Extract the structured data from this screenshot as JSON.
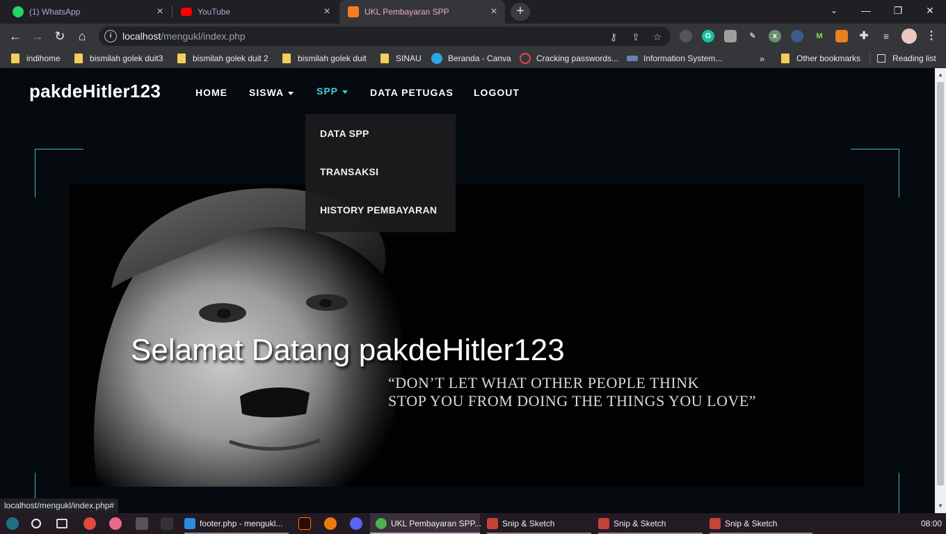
{
  "browser": {
    "tabs": [
      {
        "title": "(1) WhatsApp",
        "icon": "whatsapp-icon",
        "color": "#25d366"
      },
      {
        "title": "YouTube",
        "icon": "youtube-icon",
        "color": "#ff0000"
      },
      {
        "title": "UKL Pembayaran SPP",
        "icon": "xampp-icon",
        "color": "#fb7a24"
      }
    ],
    "new_tab": "+",
    "url_host": "localhost",
    "url_path": "/mengukl/index.php",
    "status_url": "localhost/mengukl/index.php#",
    "bookmarks": [
      {
        "label": "indihome",
        "type": "folder"
      },
      {
        "label": "bismilah golek duit3",
        "type": "folder"
      },
      {
        "label": "bismilah golek duit 2",
        "type": "folder"
      },
      {
        "label": "bismilah golek duit",
        "type": "folder"
      },
      {
        "label": "SINAU",
        "type": "folder"
      },
      {
        "label": "Beranda - Canva",
        "type": "canva"
      },
      {
        "label": "Cracking passwords...",
        "type": "site"
      },
      {
        "label": "Information System...",
        "type": "site"
      }
    ],
    "bookmarks_overflow": "»",
    "other_bookmarks": "Other bookmarks",
    "reading_list": "Reading list"
  },
  "site": {
    "brand": "pakdeHitler123",
    "nav": {
      "home": "HOME",
      "siswa": "SISWA",
      "spp": "SPP",
      "petugas": "DATA PETUGAS",
      "logout": "LOGOUT"
    },
    "spp_dropdown": [
      "DATA SPP",
      "TRANSAKSI",
      "HISTORY PEMBAYARAN"
    ],
    "hero": {
      "welcome": "Selamat Datang pakdeHitler123",
      "quote_line1": "“DON’T LET WHAT OTHER PEOPLE THINK",
      "quote_line2": "STOP YOU FROM DOING THE THINGS YOU LOVE”"
    },
    "accent_color": "#3fd0e0"
  },
  "taskbar": {
    "apps": [
      {
        "label": "footer.php - mengukl...",
        "icon": "vscode-icon"
      },
      {
        "label": "UKL Pembayaran SPP...",
        "icon": "chrome-icon"
      },
      {
        "label": "Snip & Sketch",
        "icon": "snip-sketch-icon"
      },
      {
        "label": "Snip & Sketch",
        "icon": "snip-sketch-icon"
      },
      {
        "label": "Snip & Sketch",
        "icon": "snip-sketch-icon"
      }
    ],
    "clock": "08:00"
  }
}
